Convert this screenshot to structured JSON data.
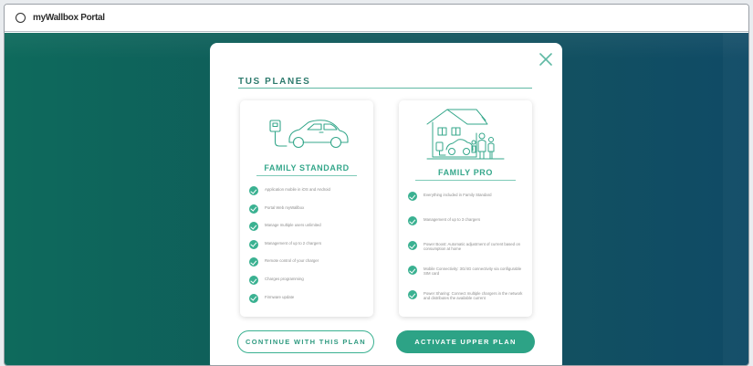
{
  "window": {
    "title": "myWallbox Portal"
  },
  "modal": {
    "heading": "TUS PLANES",
    "plans": [
      {
        "name": "FAMILY STANDARD",
        "illustration": "charger-car-icon",
        "features": [
          "Application mobile in iOS and Android",
          "Portal Web myWallbox",
          "Manage multiple users unlimited",
          "Management of up to 2 chargers",
          "Remote control of your charger",
          "Charges programming",
          "Firmware update"
        ]
      },
      {
        "name": "FAMILY PRO",
        "illustration": "house-family-icon",
        "features": [
          "Everything included in Family Standard",
          "Management of up to 3 chargers",
          "Power Boost: Automatic adjustment of current based on consumption at home",
          "Mobile Connectivity: 3G/4G connectivity via configurable SIM card",
          "Power Sharing: Connect multiple chargers in the network and distributes the available current"
        ]
      }
    ],
    "buttons": {
      "continue_label": "CONTINUE WITH THIS PLAN",
      "activate_label": "ACTIVATE UPPER PLAN"
    }
  },
  "colors": {
    "accent": "#35a78b",
    "button_fill": "#2da386",
    "backdrop_left": "#0e6a5c",
    "backdrop_right": "#0f4a66"
  }
}
